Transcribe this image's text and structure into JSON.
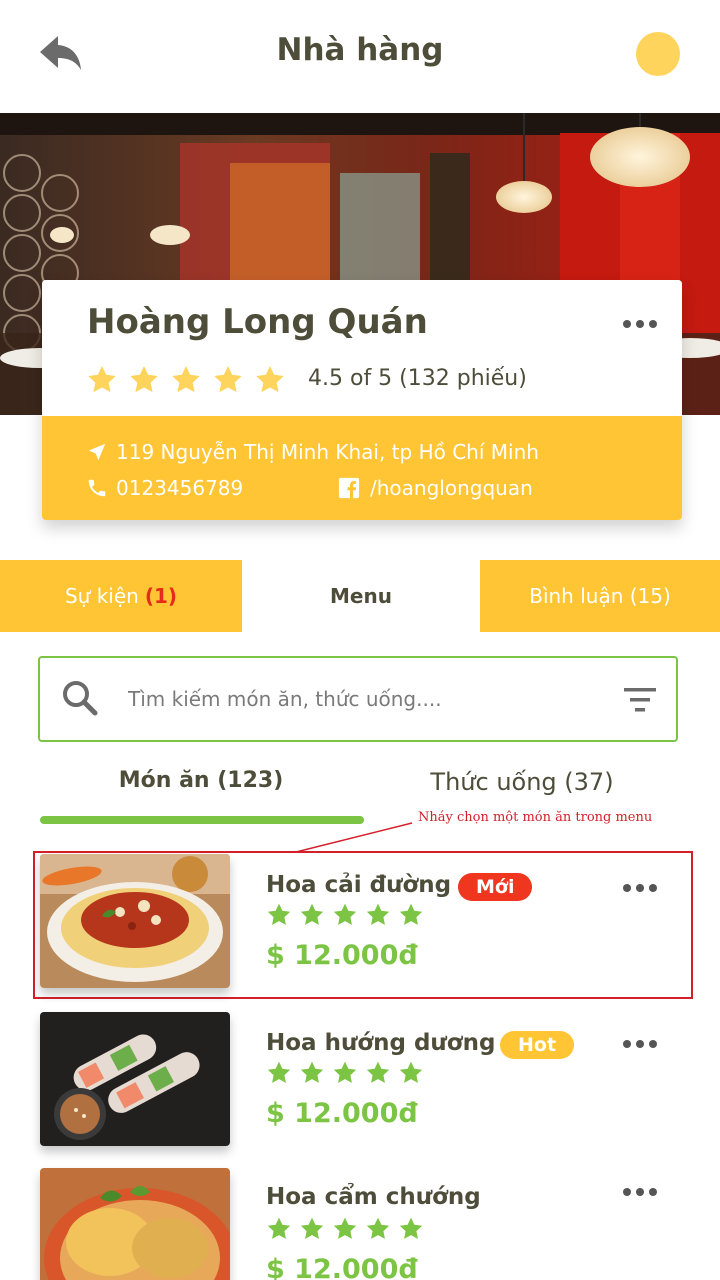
{
  "header": {
    "title": "Nhà hàng",
    "back_icon": "back-arrow-icon",
    "avatar_color": "#ffd45c"
  },
  "restaurant": {
    "name": "Hoàng Long Quán",
    "rating_value": 4.5,
    "rating_max": 5,
    "rating_text": "4.5 of 5 (132 phiếu)",
    "address": "119 Nguyễn Thị Minh Khai, tp Hồ Chí Minh",
    "phone": "0123456789",
    "facebook": "/hoanglongquan"
  },
  "tabs": {
    "events_label": "Sự kiện",
    "events_count": "(1)",
    "menu_label": "Menu",
    "reviews_label": "Bình luận (15)"
  },
  "search": {
    "placeholder": "Tìm kiếm món ăn, thức uống...."
  },
  "categories": {
    "food": "Món ăn (123)",
    "drink": "Thức uống (37)"
  },
  "annotation": {
    "text": "Nháy chọn một món ăn trong menu"
  },
  "menu_items": [
    {
      "name": "Hoa cải đường",
      "badge": "Mới",
      "rating": 5,
      "price": "$ 12.000đ"
    },
    {
      "name": "Hoa hướng dương",
      "badge": "Hot",
      "rating": 5,
      "price": "$ 12.000đ"
    },
    {
      "name": "Hoa cẩm chướng",
      "badge": "",
      "rating": 5,
      "price": "$ 12.000đ"
    }
  ],
  "colors": {
    "accent_yellow": "#ffc535",
    "accent_green": "#7cc444",
    "badge_red": "#f0361f",
    "annotation_red": "#d4202a",
    "text_dark": "#4e4d3a"
  }
}
